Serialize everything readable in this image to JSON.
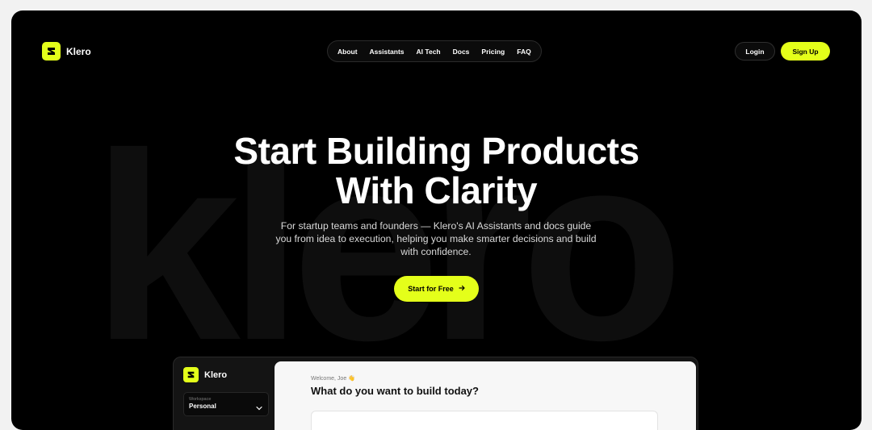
{
  "brand": {
    "name": "Klero",
    "watermark": "klero",
    "accent": "#e4ff1a"
  },
  "nav": {
    "items": [
      "About",
      "Assistants",
      "AI Tech",
      "Docs",
      "Pricing",
      "FAQ"
    ]
  },
  "auth": {
    "login": "Login",
    "signup": "Sign Up"
  },
  "hero": {
    "headline_line1": "Start Building Products",
    "headline_line2": "With Clarity",
    "subtitle": "For startup teams and founders — Klero's AI Assistants and docs guide you from idea to execution, helping you make smarter decisions and build with confidence.",
    "cta": "Start for Free",
    "cta_icon": "arrow-right-icon"
  },
  "app_preview": {
    "brand": "Klero",
    "workspace_label": "Workspace",
    "workspace_value": "Personal",
    "welcome": "Welcome, Joe 👋",
    "question": "What do you want to build today?"
  }
}
